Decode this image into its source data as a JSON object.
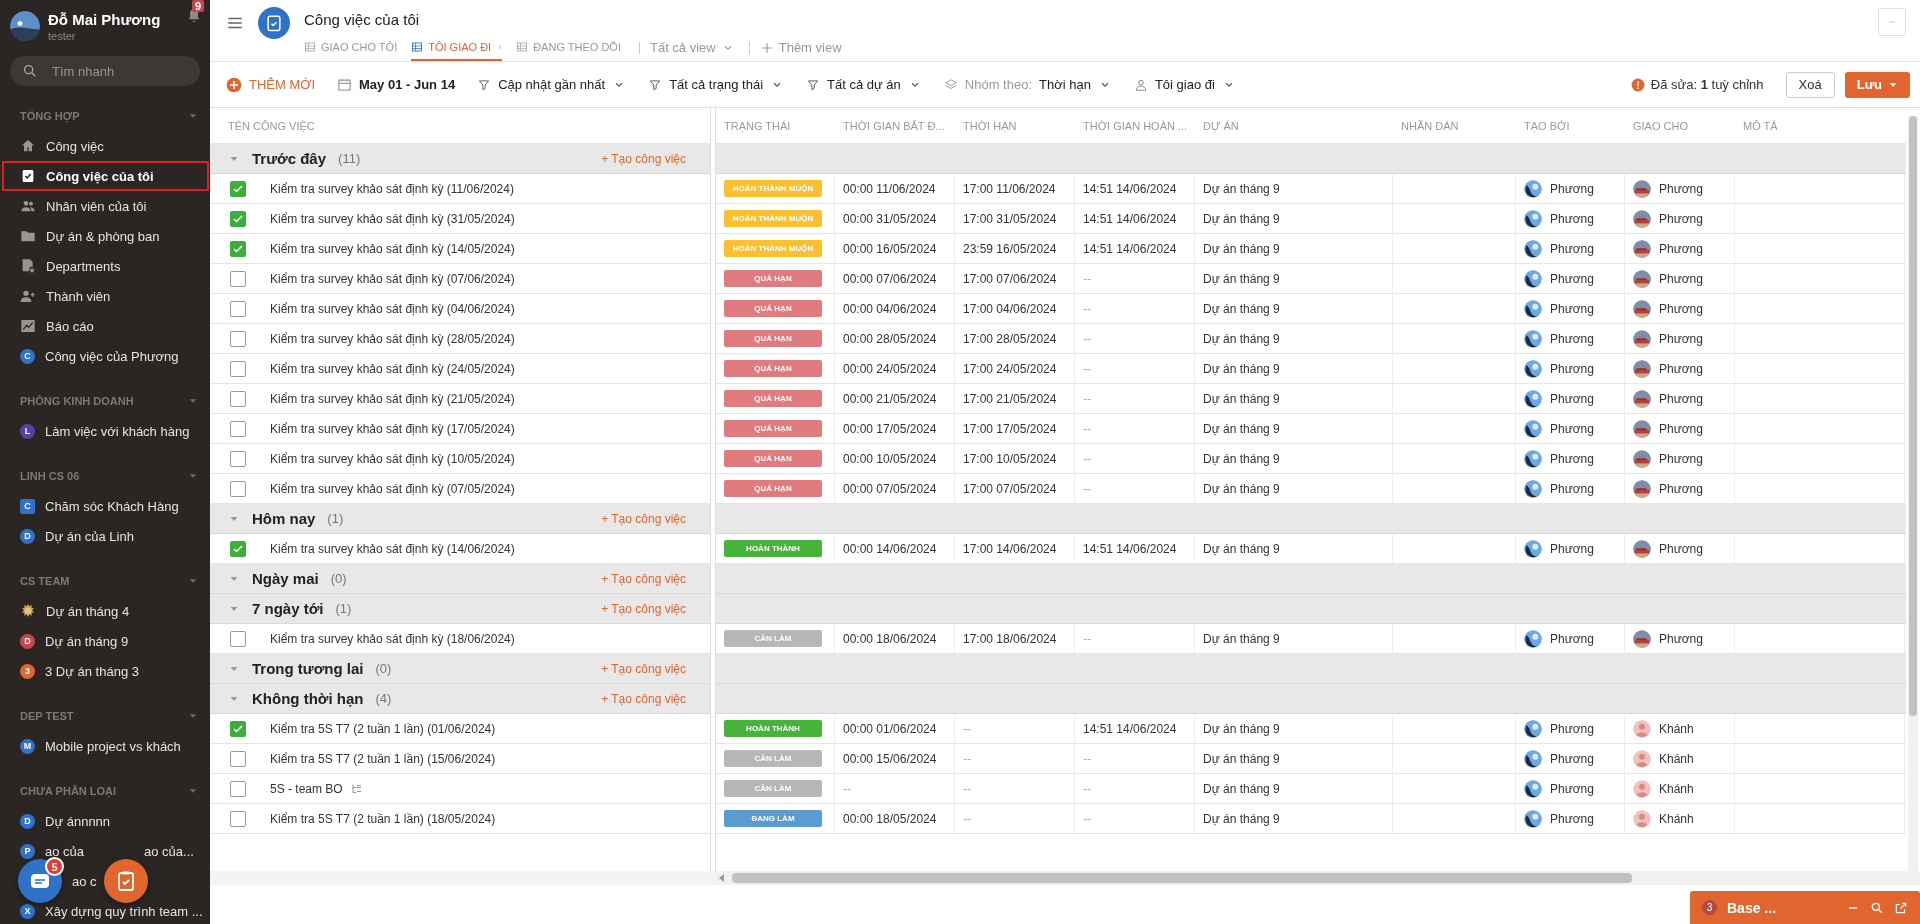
{
  "sidebar": {
    "user": {
      "name": "Đỗ Mai Phương",
      "role": "tester"
    },
    "notification_count": "9",
    "search": {
      "placeholder": "Tìm nhanh"
    },
    "sections": [
      {
        "title": "TỔNG HỢP",
        "items": [
          {
            "kind": "home",
            "label": "Công việc",
            "selected": false
          },
          {
            "kind": "task",
            "label": "Công việc của tôi",
            "selected": true
          },
          {
            "kind": "people",
            "label": "Nhân viên của tôi",
            "selected": false
          },
          {
            "kind": "folder",
            "label": "Dự án & phòng ban",
            "selected": false
          },
          {
            "kind": "department",
            "label": "Departments",
            "selected": false
          },
          {
            "kind": "member",
            "label": "Thành viên",
            "selected": false
          },
          {
            "kind": "chart",
            "label": "Báo cáo",
            "selected": false
          },
          {
            "kind": "letter",
            "letter": "C",
            "color": "#2f72c8",
            "label": "Công việc của Phương",
            "selected": false
          }
        ]
      },
      {
        "title": "PHÒNG KINH DOANH",
        "items": [
          {
            "kind": "letter",
            "letter": "L",
            "color": "#5b3fa8",
            "label": "Làm việc với khách hàng",
            "selected": false
          }
        ]
      },
      {
        "title": "LINH CS 06",
        "items": [
          {
            "kind": "tile",
            "letter": "C",
            "color": "#2f72c8",
            "label": "Chăm sóc Khách Hàng",
            "selected": false
          },
          {
            "kind": "letter",
            "letter": "D",
            "color": "#2f72c8",
            "label": "Dự án của Linh",
            "selected": false
          }
        ]
      },
      {
        "title": "CS TEAM",
        "items": [
          {
            "kind": "sun",
            "label": "Dự án tháng 4",
            "selected": false
          },
          {
            "kind": "letter",
            "letter": "D",
            "color": "#c8474f",
            "label": "Dự án tháng 9",
            "selected": false
          },
          {
            "kind": "letter",
            "letter": "3",
            "color": "#e0652f",
            "label": "3 Dự án tháng 3",
            "selected": false
          }
        ]
      },
      {
        "title": "DEP TEST",
        "items": [
          {
            "kind": "letter",
            "letter": "M",
            "color": "#2f72c8",
            "label": "Mobile project vs khách",
            "selected": false
          }
        ]
      },
      {
        "title": "CHƯA PHÂN LOẠI",
        "items": [
          {
            "kind": "letter",
            "letter": "D",
            "color": "#2f72c8",
            "label": "Dự ánnnnn",
            "selected": false
          },
          {
            "kind": "letter",
            "letter": "P",
            "color": "#2f72c8",
            "label": "ao của",
            "label_after": "ao của...",
            "selected": false
          },
          {
            "kind": "covered",
            "label": "ao c",
            "selected": false
          },
          {
            "kind": "letter",
            "letter": "X",
            "color": "#2f72c8",
            "label": "Xây dựng quy trình team ...",
            "selected": false
          }
        ]
      }
    ],
    "chat_badge": "5"
  },
  "header": {
    "title": "Công việc của tôi",
    "tabs": [
      {
        "label": "GIAO CHO TÔI",
        "selected": false
      },
      {
        "label": "TÔI GIAO ĐI",
        "selected": true
      },
      {
        "label": "ĐANG THEO DÕI",
        "selected": false
      }
    ],
    "view_menu": "Tất cả view",
    "add_view": "Thêm view"
  },
  "toolbar": {
    "add_label": "THÊM MỚI",
    "date_range": "May 01 - Jun 14",
    "filters": [
      "Cập nhật gần nhất",
      "Tất cả trạng thái",
      "Tất cả dự án"
    ],
    "group_by": {
      "label": "Nhóm theo:",
      "value": "Thời hạn"
    },
    "person_filter": "Tôi giao đi",
    "edited_note": "Đã sửa: **1** tuỳ chỉnh",
    "clear_label": "Xoá",
    "save_label": "Lưu"
  },
  "table": {
    "name_column": "TÊN CÔNG VIỆC",
    "columns": [
      "TRẠNG THÁI",
      "THỜI GIAN BẮT Đ...",
      "THỜI HẠN",
      "THỜI GIAN HOÀN ...",
      "DỰ ÁN",
      "NHÃN DÁN",
      "TẠO BỞI",
      "GIAO CHO",
      "MÔ TẢ"
    ],
    "groups": [
      {
        "title": "Trước đây",
        "count": "(11)",
        "add_label": "+ Tạo công việc",
        "rows": [
          {
            "checked": true,
            "name": "Kiểm tra survey khảo sát định kỳ (11/06/2024)",
            "status": {
              "kind": "late",
              "label": "HOÀN THÀNH MUỘN"
            },
            "start": "00:00 11/06/2024",
            "deadline": "17:00 11/06/2024",
            "done": "14:51 14/06/2024",
            "project": "Dự án tháng 9",
            "created_by": "Phương",
            "assignee": {
              "name": "Phương",
              "kind": "car"
            }
          },
          {
            "checked": true,
            "name": "Kiểm tra survey khảo sát định kỳ (31/05/2024)",
            "status": {
              "kind": "late",
              "label": "HOÀN THÀNH MUỘN"
            },
            "start": "00:00 31/05/2024",
            "deadline": "17:00 31/05/2024",
            "done": "14:51 14/06/2024",
            "project": "Dự án tháng 9",
            "created_by": "Phương",
            "assignee": {
              "name": "Phương",
              "kind": "car"
            }
          },
          {
            "checked": true,
            "name": "Kiểm tra survey khảo sát định kỳ (14/05/2024)",
            "status": {
              "kind": "late",
              "label": "HOÀN THÀNH MUỘN"
            },
            "start": "00:00 16/05/2024",
            "deadline": "23:59 16/05/2024",
            "done": "14:51 14/06/2024",
            "project": "Dự án tháng 9",
            "created_by": "Phương",
            "assignee": {
              "name": "Phương",
              "kind": "car"
            }
          },
          {
            "checked": false,
            "name": "Kiểm tra survey khảo sát định kỳ (07/06/2024)",
            "status": {
              "kind": "overdue",
              "label": "QUÁ HẠN"
            },
            "start": "00:00 07/06/2024",
            "deadline": "17:00 07/06/2024",
            "done": "--",
            "project": "Dự án tháng 9",
            "created_by": "Phương",
            "assignee": {
              "name": "Phương",
              "kind": "car"
            }
          },
          {
            "checked": false,
            "name": "Kiểm tra survey khảo sát định kỳ (04/06/2024)",
            "status": {
              "kind": "overdue",
              "label": "QUÁ HẠN"
            },
            "start": "00:00 04/06/2024",
            "deadline": "17:00 04/06/2024",
            "done": "--",
            "project": "Dự án tháng 9",
            "created_by": "Phương",
            "assignee": {
              "name": "Phương",
              "kind": "car"
            }
          },
          {
            "checked": false,
            "name": "Kiểm tra survey khảo sát định kỳ (28/05/2024)",
            "status": {
              "kind": "overdue",
              "label": "QUÁ HẠN"
            },
            "start": "00:00 28/05/2024",
            "deadline": "17:00 28/05/2024",
            "done": "--",
            "project": "Dự án tháng 9",
            "created_by": "Phương",
            "assignee": {
              "name": "Phương",
              "kind": "car"
            }
          },
          {
            "checked": false,
            "name": "Kiểm tra survey khảo sát định kỳ (24/05/2024)",
            "status": {
              "kind": "overdue",
              "label": "QUÁ HẠN"
            },
            "start": "00:00 24/05/2024",
            "deadline": "17:00 24/05/2024",
            "done": "--",
            "project": "Dự án tháng 9",
            "created_by": "Phương",
            "assignee": {
              "name": "Phương",
              "kind": "car"
            }
          },
          {
            "checked": false,
            "name": "Kiểm tra survey khảo sát định kỳ (21/05/2024)",
            "status": {
              "kind": "overdue",
              "label": "QUÁ HẠN"
            },
            "start": "00:00 21/05/2024",
            "deadline": "17:00 21/05/2024",
            "done": "--",
            "project": "Dự án tháng 9",
            "created_by": "Phương",
            "assignee": {
              "name": "Phương",
              "kind": "car"
            }
          },
          {
            "checked": false,
            "name": "Kiểm tra survey khảo sát định kỳ (17/05/2024)",
            "status": {
              "kind": "overdue",
              "label": "QUÁ HẠN"
            },
            "start": "00:00 17/05/2024",
            "deadline": "17:00 17/05/2024",
            "done": "--",
            "project": "Dự án tháng 9",
            "created_by": "Phương",
            "assignee": {
              "name": "Phương",
              "kind": "car"
            }
          },
          {
            "checked": false,
            "name": "Kiểm tra survey khảo sát định kỳ (10/05/2024)",
            "status": {
              "kind": "overdue",
              "label": "QUÁ HẠN"
            },
            "start": "00:00 10/05/2024",
            "deadline": "17:00 10/05/2024",
            "done": "--",
            "project": "Dự án tháng 9",
            "created_by": "Phương",
            "assignee": {
              "name": "Phương",
              "kind": "car"
            }
          },
          {
            "checked": false,
            "name": "Kiểm tra survey khảo sát định kỳ (07/05/2024)",
            "status": {
              "kind": "overdue",
              "label": "QUÁ HẠN"
            },
            "start": "00:00 07/05/2024",
            "deadline": "17:00 07/05/2024",
            "done": "--",
            "project": "Dự án tháng 9",
            "created_by": "Phương",
            "assignee": {
              "name": "Phương",
              "kind": "car"
            }
          }
        ]
      },
      {
        "title": "Hôm nay",
        "count": "(1)",
        "add_label": "+ Tạo công việc",
        "rows": [
          {
            "checked": true,
            "name": "Kiểm tra survey khảo sát định kỳ (14/06/2024)",
            "status": {
              "kind": "done",
              "label": "HOÀN THÀNH"
            },
            "start": "00:00 14/06/2024",
            "deadline": "17:00 14/06/2024",
            "done": "14:51 14/06/2024",
            "project": "Dự án tháng 9",
            "created_by": "Phương",
            "assignee": {
              "name": "Phương",
              "kind": "car"
            }
          }
        ]
      },
      {
        "title": "Ngày mai",
        "count": "(0)",
        "add_label": "+ Tạo công việc"
      },
      {
        "title": "7 ngày tới",
        "count": "(1)",
        "add_label": "+ Tạo công việc",
        "rows": [
          {
            "checked": false,
            "name": "Kiểm tra survey khảo sát định kỳ (18/06/2024)",
            "status": {
              "kind": "todo",
              "label": "CẦN LÀM"
            },
            "start": "00:00 18/06/2024",
            "deadline": "17:00 18/06/2024",
            "done": "--",
            "project": "Dự án tháng 9",
            "created_by": "Phương",
            "assignee": {
              "name": "Phương",
              "kind": "car"
            }
          }
        ]
      },
      {
        "title": "Trong tương lai",
        "count": "(0)",
        "add_label": "+ Tạo công việc"
      },
      {
        "title": "Không thời hạn",
        "count": "(4)",
        "add_label": "+ Tạo công việc",
        "rows": [
          {
            "checked": true,
            "name": "Kiểm tra 5S T7 (2 tuần 1 lần) (01/06/2024)",
            "status": {
              "kind": "done",
              "label": "HOÀN THÀNH"
            },
            "start": "00:00 01/06/2024",
            "deadline": "--",
            "done": "14:51 14/06/2024",
            "project": "Dự án tháng 9",
            "created_by": "Phương",
            "assignee": {
              "name": "Khánh",
              "kind": "person"
            }
          },
          {
            "checked": false,
            "name": "Kiểm tra 5S T7 (2 tuần 1 lần) (15/06/2024)",
            "status": {
              "kind": "todo",
              "label": "CẦN LÀM"
            },
            "start": "00:00 15/06/2024",
            "deadline": "--",
            "done": "--",
            "project": "Dự án tháng 9",
            "created_by": "Phương",
            "assignee": {
              "name": "Khánh",
              "kind": "person"
            }
          },
          {
            "checked": false,
            "name": "5S - team BO",
            "has_subtasks": true,
            "status": {
              "kind": "todo",
              "label": "CẦN LÀM"
            },
            "start": "--",
            "deadline": "--",
            "done": "--",
            "project": "Dự án tháng 9",
            "created_by": "Phương",
            "assignee": {
              "name": "Khánh",
              "kind": "person"
            }
          },
          {
            "checked": false,
            "name": "Kiểm tra 5S T7 (2 tuần 1 lần) (18/05/2024)",
            "status": {
              "kind": "doing",
              "label": "ĐANG LÀM"
            },
            "start": "00:00 18/05/2024",
            "deadline": "--",
            "done": "--",
            "project": "Dự án tháng 9",
            "created_by": "Phương",
            "assignee": {
              "name": "Khánh",
              "kind": "person"
            }
          }
        ]
      }
    ]
  },
  "chat_panel": {
    "title": "Base ...",
    "badge": "3"
  }
}
